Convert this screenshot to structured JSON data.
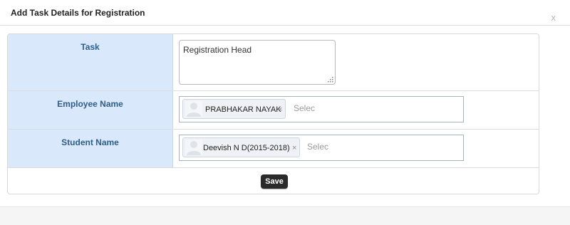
{
  "dialog": {
    "title": "Add Task Details for Registration",
    "close_label": "x"
  },
  "form": {
    "task": {
      "label": "Task",
      "value": "Registration Head"
    },
    "employee": {
      "label": "Employee Name",
      "selected": "PRABHAKAR NAYAK",
      "remove_label": "×",
      "placeholder": "Selec"
    },
    "student": {
      "label": "Student Name",
      "selected": "Deevish N D(2015-2018)",
      "remove_label": "×",
      "placeholder": "Selec"
    },
    "save_label": "Save"
  },
  "icons": {
    "resize": "resize-grip-icon",
    "chip_avatar": "user-avatar-icon"
  },
  "colors": {
    "label_bg": "#d9e8fb",
    "label_text": "#2e5e8c",
    "save_bg": "#2a2a2a"
  }
}
